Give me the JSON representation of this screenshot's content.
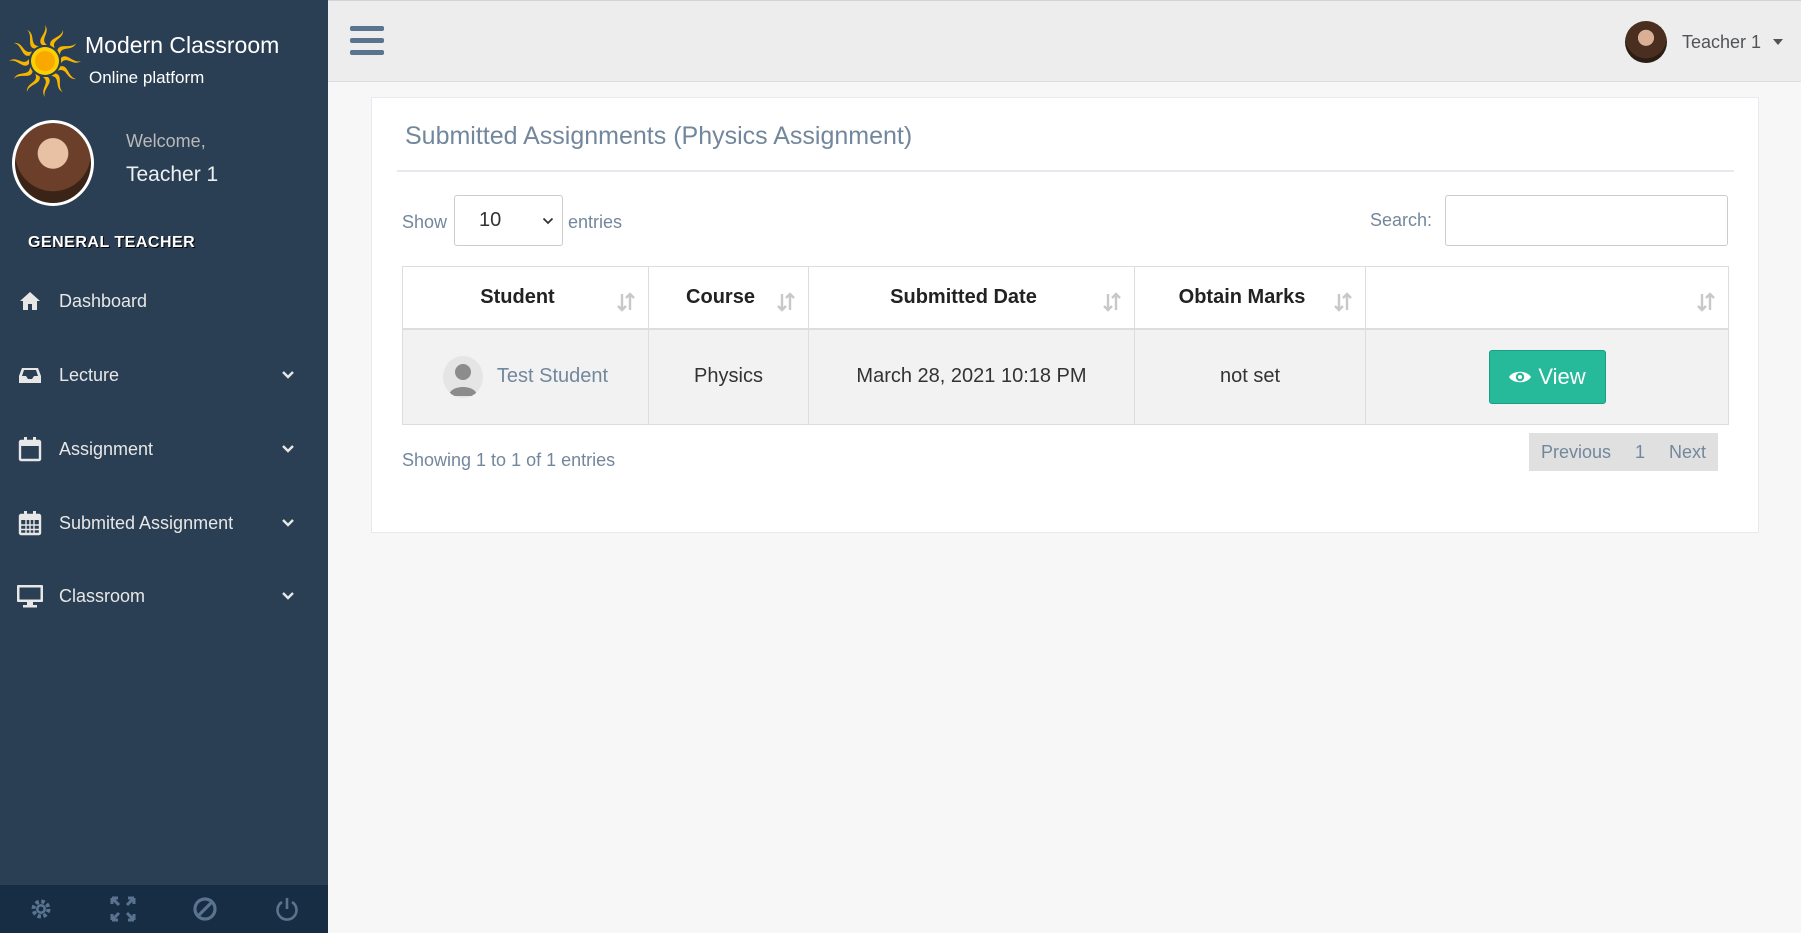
{
  "brand": {
    "title": "Modern Classroom",
    "subtitle": "Online platform"
  },
  "profile": {
    "welcome": "Welcome,",
    "name": "Teacher 1"
  },
  "sidebar": {
    "section_title": "GENERAL TEACHER",
    "items": [
      {
        "label": "Dashboard",
        "icon": "home-icon",
        "has_children": false
      },
      {
        "label": "Lecture",
        "icon": "inbox-icon",
        "has_children": true
      },
      {
        "label": "Assignment",
        "icon": "calendar-icon",
        "has_children": true
      },
      {
        "label": "Submited Assignment",
        "icon": "calendar-grid-icon",
        "has_children": true
      },
      {
        "label": "Classroom",
        "icon": "desktop-icon",
        "has_children": true
      }
    ],
    "footer_icons": [
      "settings-icon",
      "fullscreen-icon",
      "lock-icon",
      "logout-icon"
    ]
  },
  "topnav": {
    "user_name": "Teacher 1"
  },
  "panel": {
    "title": "Submitted Assignments (Physics Assignment)",
    "show_label": "Show",
    "entries_value": "10",
    "entries_label": "entries",
    "search_label": "Search:",
    "search_value": ""
  },
  "table": {
    "headers": [
      "Student",
      "Course",
      "Submitted Date",
      "Obtain Marks",
      ""
    ],
    "rows": [
      {
        "student": "Test Student",
        "course": "Physics",
        "date": "March 28, 2021 10:18 PM",
        "marks": "not set",
        "action": "View"
      }
    ]
  },
  "footer_info": "Showing 1 to 1 of 1 entries",
  "pagination": {
    "previous": "Previous",
    "current": "1",
    "next": "Next"
  },
  "colors": {
    "sidebar": "#2a3f54",
    "accent": "#26b99a",
    "body": "#f7f7f7"
  }
}
